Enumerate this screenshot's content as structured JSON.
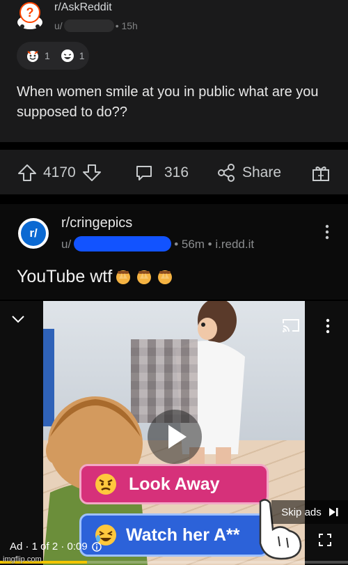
{
  "post1": {
    "subreddit": "r/AskReddit",
    "user_prefix": "u/",
    "age": "• 15h",
    "awards": [
      {
        "icon": "wholesome-award-icon",
        "count": "1"
      },
      {
        "icon": "laughing-award-icon",
        "count": "1"
      }
    ],
    "title": "When women smile at you in public what are you supposed to do??",
    "actions": {
      "upvotes": "4170",
      "comments": "316",
      "share": "Share"
    }
  },
  "post2": {
    "subreddit": "r/cringepics",
    "user_prefix": "u/",
    "meta": "• 56m • i.redd.it",
    "avatar_text": "r/",
    "title": "YouTube wtf"
  },
  "video": {
    "choice_1": "Look Away",
    "choice_2": "Watch her A**",
    "skip_label": "Skip ads",
    "ad_info": "Ad · 1 of 2 · 0:09",
    "progress": 0.25,
    "accent": "#f2c500"
  },
  "watermark": "imgflip.com",
  "colors": {
    "background": "#1a1a1b",
    "text": "#d7dadc",
    "meta": "#818384",
    "redaction": "#1253ff"
  }
}
